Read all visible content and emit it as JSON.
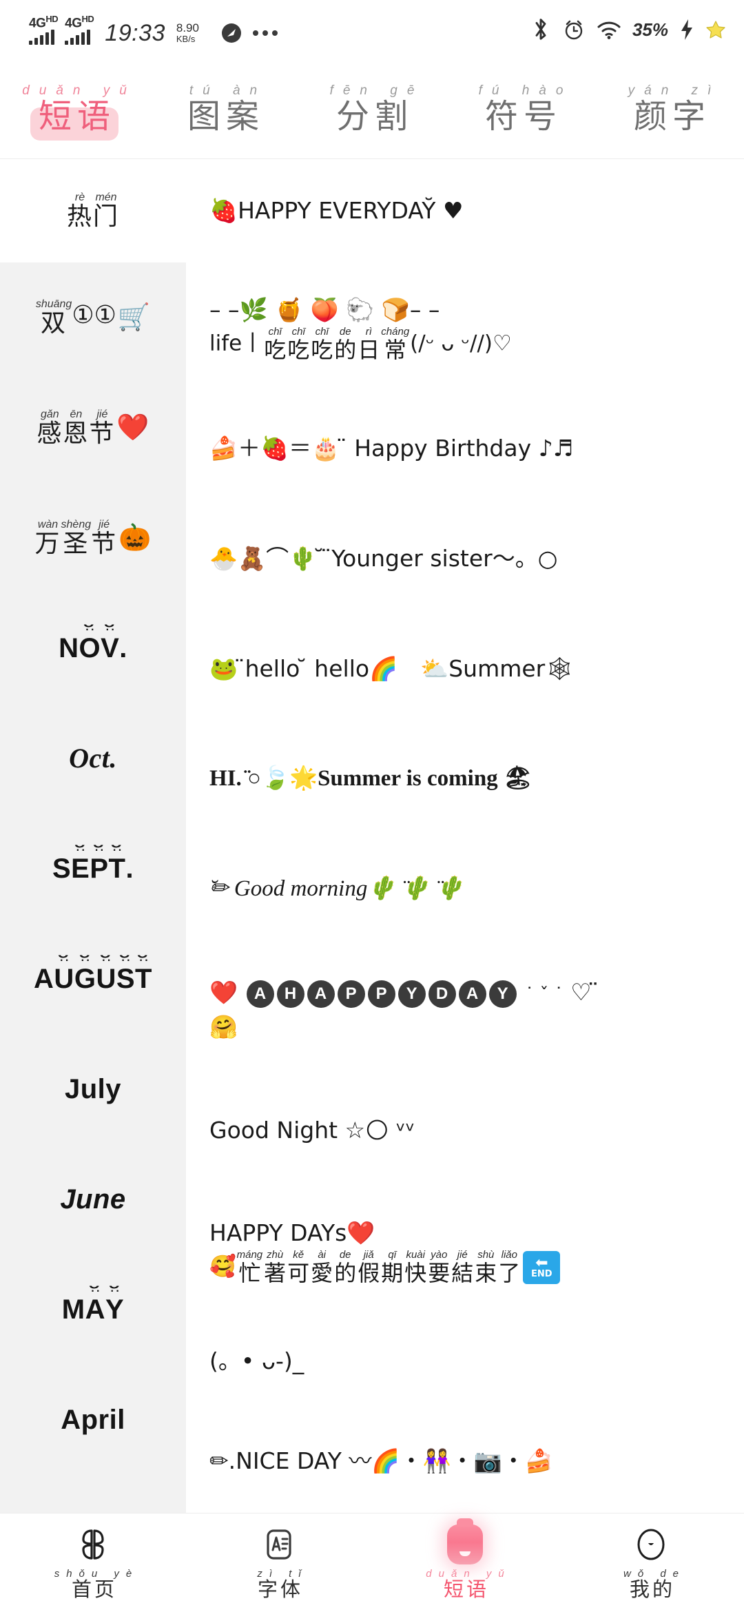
{
  "status_bar": {
    "network_label": "4G",
    "network_sup": "HD",
    "time": "19:33",
    "net_speed_value": "8.90",
    "net_speed_unit": "KB/s",
    "battery_percent": "35%",
    "icons": [
      "compass-icon",
      "more-dots-icon",
      "bluetooth-icon",
      "alarm-icon",
      "wifi-icon",
      "charging-bolt-icon",
      "star-icon"
    ]
  },
  "top_tabs": [
    {
      "pinyin": "duǎn yǔ",
      "label": "短语",
      "active": true
    },
    {
      "pinyin": "tú àn",
      "label": "图案",
      "active": false
    },
    {
      "pinyin": "fēn gē",
      "label": "分割",
      "active": false
    },
    {
      "pinyin": "fú hào",
      "label": "符号",
      "active": false
    },
    {
      "pinyin": "yán zì",
      "label": "颜字",
      "active": false
    }
  ],
  "sidebar": {
    "items": [
      {
        "type": "ruby",
        "active": true,
        "ruby": [
          {
            "py": "rè",
            "ch": "热"
          },
          {
            "py": "mén",
            "ch": "门"
          }
        ],
        "emoji": ""
      },
      {
        "type": "ruby",
        "active": false,
        "ruby": [
          {
            "py": "shuāng",
            "ch": "双"
          }
        ],
        "extra": "①①",
        "emoji": "🛒"
      },
      {
        "type": "ruby",
        "active": false,
        "ruby": [
          {
            "py": "gǎn",
            "ch": "感"
          },
          {
            "py": "ēn",
            "ch": "恩"
          },
          {
            "py": "jié",
            "ch": "节"
          }
        ],
        "emoji": "❤️"
      },
      {
        "type": "ruby",
        "active": false,
        "ruby": [
          {
            "py": "wàn",
            "ch": "万"
          },
          {
            "py": "shèng",
            "ch": "圣"
          },
          {
            "py": "jié",
            "ch": "节"
          }
        ],
        "emoji": "🎃"
      },
      {
        "type": "latin",
        "active": false,
        "label": "Nov.",
        "style": "smile2"
      },
      {
        "type": "latin",
        "active": false,
        "label": "Oct.",
        "style": "serif-ital"
      },
      {
        "type": "latin",
        "active": false,
        "label": "Sept.",
        "style": "smile4"
      },
      {
        "type": "latin",
        "active": false,
        "label": "August",
        "style": "smile5"
      },
      {
        "type": "latin",
        "active": false,
        "label": "July",
        "style": "outline"
      },
      {
        "type": "latin",
        "active": false,
        "label": "June",
        "style": "bold-ital"
      },
      {
        "type": "latin",
        "active": false,
        "label": "May",
        "style": "smile2"
      },
      {
        "type": "latin",
        "active": false,
        "label": "April",
        "style": "outline"
      }
    ]
  },
  "phrases": [
    {
      "id": "happy-everyday",
      "lines": [
        {
          "text": "🍓HAPPY EVERYDAY̆ ♥",
          "font": "sans"
        }
      ]
    },
    {
      "id": "life-chichichi",
      "lines": [
        {
          "text": "– –🌿 🍯 🍑 🐑 🍞– –",
          "font": "sans"
        },
        {
          "text": "life丨吃吃吃的日常(/ᵕ ᴗ ᵕ//)♡",
          "font": "ruby",
          "ruby": [
            {
              "py": "chī",
              "ch": "吃"
            },
            {
              "py": "chī",
              "ch": "吃"
            },
            {
              "py": "chī",
              "ch": "吃"
            },
            {
              "py": "de",
              "ch": "的"
            },
            {
              "py": "rì",
              "ch": "日"
            },
            {
              "py": "cháng",
              "ch": "常"
            }
          ],
          "prefix": "life丨",
          "suffix": "(/ᵕ ᴗ ᵕ//)♡"
        }
      ]
    },
    {
      "id": "happy-birthday",
      "lines": [
        {
          "text": "🍰＋🍓＝🎂 ̈ Happy Birthday ♪♬",
          "font": "sans"
        }
      ]
    },
    {
      "id": "younger-sister",
      "lines": [
        {
          "text": "🐣🧸⌒🌵 ̆ ̈Younger sister〜。○",
          "font": "sans"
        }
      ]
    },
    {
      "id": "hello-summer",
      "lines": [
        {
          "text": "🐸 ̈hello ̆ hello🌈　⛅Summer🕸",
          "font": "sans"
        }
      ]
    },
    {
      "id": "summer-is-coming",
      "lines": [
        {
          "text": "HI. ̈○🍃🌟Summer is coming 🏖",
          "font": "serif"
        }
      ]
    },
    {
      "id": "good-morning",
      "lines": [
        {
          "text": "̆✏ Good morning🌵 ̈🌵 ̈🌵",
          "font": "ital"
        }
      ]
    },
    {
      "id": "a-happy-day",
      "lines": [
        {
          "text": "❤️ Ⓐ Ⓗ Ⓐ Ⓟ Ⓟ Ⓨ Ⓓ Ⓐ Ⓨ ˙ ˇ ˙ ♡ ̈",
          "font": "circled",
          "circled": [
            "A",
            "H",
            "A",
            "P",
            "P",
            "Y",
            "D",
            "A",
            "Y"
          ]
        },
        {
          "text": "🤗",
          "font": "sans"
        }
      ]
    },
    {
      "id": "good-night",
      "lines": [
        {
          "text": "Good Night ☆🌕 ᵛᵛ",
          "font": "sans"
        }
      ]
    },
    {
      "id": "happy-days",
      "lines": [
        {
          "text": "HAPPY DAYs❤️",
          "font": "sans"
        },
        {
          "text": "🥰忙著可愛的假期快要結束了🔚",
          "font": "ruby",
          "ruby": [
            {
              "py": "máng",
              "ch": "忙"
            },
            {
              "py": "zhù",
              "ch": "著"
            },
            {
              "py": "kě",
              "ch": "可"
            },
            {
              "py": "ài",
              "ch": "愛"
            },
            {
              "py": "de",
              "ch": "的"
            },
            {
              "py": "jiǎ",
              "ch": "假"
            },
            {
              "py": "qī",
              "ch": "期"
            },
            {
              "py": "kuài",
              "ch": "快"
            },
            {
              "py": "yào",
              "ch": "要"
            },
            {
              "py": "jié",
              "ch": "結"
            },
            {
              "py": "shù",
              "ch": "束"
            },
            {
              "py": "liǎo",
              "ch": "了"
            }
          ],
          "prefix": "🥰",
          "suffix": "END"
        }
      ]
    },
    {
      "id": "kaomoji",
      "lines": [
        {
          "text": "(。• ᴗ-)_",
          "font": "sans"
        }
      ]
    },
    {
      "id": "nice-day",
      "lines": [
        {
          "text": "✏.NICE DAY 〰🌈・👭・📷・🍰",
          "font": "sans"
        }
      ]
    }
  ],
  "bottom_nav": [
    {
      "icon": "grid-icon",
      "pinyin": "shǒu yè",
      "label": "首页",
      "active": false
    },
    {
      "icon": "font-a-icon",
      "pinyin": "zì tǐ",
      "label": "字体",
      "active": false
    },
    {
      "icon": "phrase-bottle-icon",
      "pinyin": "duǎn yǔ",
      "label": "短语",
      "active": true
    },
    {
      "icon": "profile-circle-icon",
      "pinyin": "wǒ de",
      "label": "我的",
      "active": false
    }
  ],
  "colors": {
    "accent_pink": "#ef5f7c",
    "accent_pink_light": "#fbd3d9",
    "sidebar_bg": "#f2f2f2",
    "page_bg": "#ffffff"
  }
}
